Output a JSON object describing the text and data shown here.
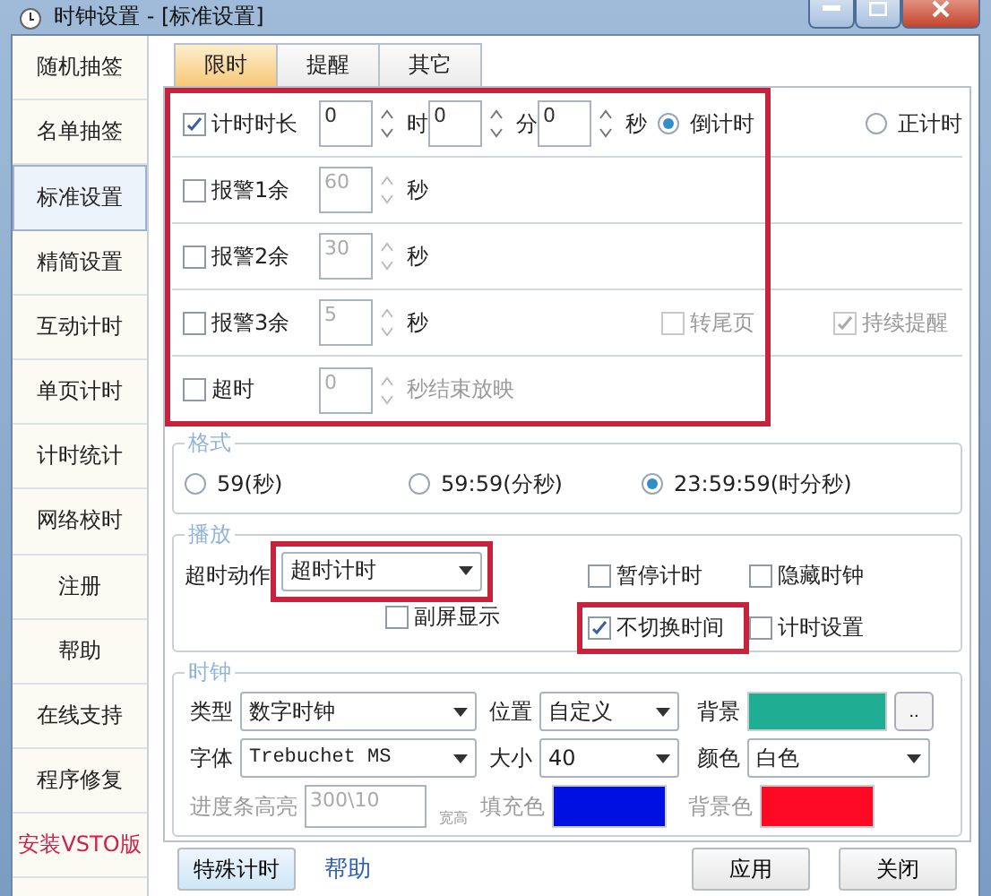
{
  "window": {
    "title": "时钟设置 - [标准设置]"
  },
  "sidebar": {
    "items": [
      {
        "label": "随机抽签",
        "selected": false,
        "kind": "nav"
      },
      {
        "label": "名单抽签",
        "selected": false,
        "kind": "nav"
      },
      {
        "label": "标准设置",
        "selected": true,
        "kind": "nav"
      },
      {
        "label": "精简设置",
        "selected": false,
        "kind": "nav"
      },
      {
        "label": "互动计时",
        "selected": false,
        "kind": "nav"
      },
      {
        "label": "单页计时",
        "selected": false,
        "kind": "nav"
      },
      {
        "label": "计时统计",
        "selected": false,
        "kind": "nav"
      },
      {
        "label": "网络校时",
        "selected": false,
        "kind": "nav"
      },
      {
        "label": "注册",
        "selected": false,
        "kind": "nav"
      },
      {
        "label": "帮助",
        "selected": false,
        "kind": "nav"
      },
      {
        "label": "在线支持",
        "selected": false,
        "kind": "nav"
      },
      {
        "label": "程序修复",
        "selected": false,
        "kind": "nav"
      },
      {
        "label": "安装VSTO版",
        "selected": false,
        "kind": "install"
      }
    ]
  },
  "tabs": [
    {
      "label": "限时",
      "selected": true
    },
    {
      "label": "提醒",
      "selected": false
    },
    {
      "label": "其它",
      "selected": false
    }
  ],
  "limit": {
    "highlighted": true,
    "duration": {
      "label": "计时时长",
      "checked": true,
      "fields": [
        {
          "value": "0",
          "unit": "时"
        },
        {
          "value": "0",
          "unit": "分"
        },
        {
          "value": "0",
          "unit": "秒"
        }
      ],
      "radios": [
        {
          "label": "倒计时",
          "selected": true
        },
        {
          "label": "正计时",
          "selected": false
        }
      ]
    },
    "alarms": [
      {
        "label": "报警1余",
        "checked": false,
        "value": "60",
        "unit": "秒"
      },
      {
        "label": "报警2余",
        "checked": false,
        "value": "30",
        "unit": "秒"
      },
      {
        "label": "报警3余",
        "checked": false,
        "value": "5",
        "unit": "秒"
      }
    ],
    "alarm_options": [
      {
        "label": "转尾页",
        "checked": false,
        "disabled": true
      },
      {
        "label": "持续提醒",
        "checked": true,
        "disabled": true
      }
    ],
    "overtime": {
      "label": "超时",
      "checked": false,
      "value": "0",
      "unit": "秒结束放映",
      "disabled": true
    }
  },
  "format": {
    "title": "格式",
    "options": [
      {
        "label": "59(秒)",
        "selected": false
      },
      {
        "label": "59:59(分秒)",
        "selected": false
      },
      {
        "label": "23:59:59(时分秒)",
        "selected": true
      }
    ]
  },
  "play": {
    "title": "播放",
    "action_label": "超时动作",
    "action_value": "超时计时",
    "action_highlighted": true,
    "options": [
      {
        "label": "暂停计时",
        "checked": false,
        "highlighted": false
      },
      {
        "label": "隐藏时钟",
        "checked": false,
        "highlighted": false
      },
      {
        "label": "副屏显示",
        "checked": false,
        "highlighted": false
      },
      {
        "label": "不切换时间",
        "checked": true,
        "highlighted": true
      },
      {
        "label": "计时设置",
        "checked": false,
        "highlighted": false
      }
    ]
  },
  "clock": {
    "title": "时钟",
    "type": {
      "label": "类型",
      "value": "数字时钟"
    },
    "position": {
      "label": "位置",
      "value": "自定义"
    },
    "background": {
      "label": "背景",
      "color": "#1fae94",
      "button": ".."
    },
    "font": {
      "label": "字体",
      "value": "Trebuchet MS"
    },
    "size": {
      "label": "大小",
      "value": "40"
    },
    "text_color": {
      "label": "颜色",
      "value": "白色"
    },
    "progress": {
      "label": "进度条高亮",
      "value": "300\\10",
      "unit": "宽高",
      "disabled": true
    },
    "fill": {
      "label": "填充色",
      "color": "#0010e0"
    },
    "bar_background": {
      "label": "背景色",
      "color": "#ff0a24"
    }
  },
  "footer": {
    "special": "特殊计时",
    "help": "帮助",
    "apply": "应用",
    "close": "关闭"
  }
}
